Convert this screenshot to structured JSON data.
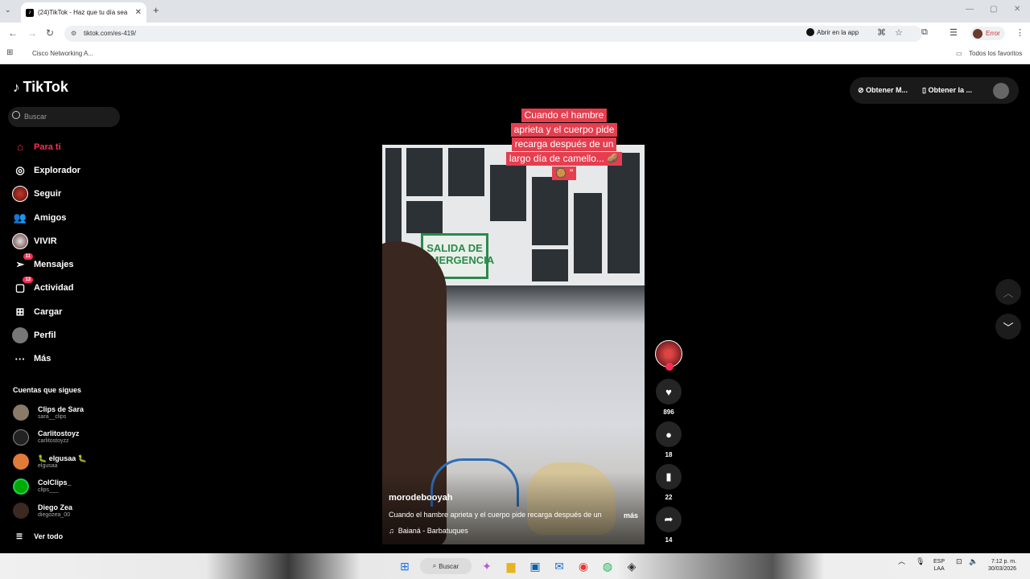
{
  "browser": {
    "tab_title": "(24)TikTok - Haz que tu día sea",
    "tab_close": "✕",
    "new_tab": "+",
    "url": "tiktok.com/es-419/",
    "open_in_app": "Abrir en la app",
    "error_label": "Error",
    "bookmark_1": "Cisco Networking A...",
    "bookmark_all": "Todos los favoritos"
  },
  "tiktok": {
    "logo": "TikTok",
    "search_placeholder": "Buscar",
    "nav": [
      {
        "label": "Para ti",
        "icon": "home-icon"
      },
      {
        "label": "Explorador",
        "icon": "compass-icon"
      },
      {
        "label": "Seguir",
        "icon": "following-avatar-icon"
      },
      {
        "label": "Amigos",
        "icon": "friends-icon"
      },
      {
        "label": "VIVIR",
        "icon": "live-icon"
      },
      {
        "label": "Mensajes",
        "icon": "messages-icon",
        "badge": "11"
      },
      {
        "label": "Actividad",
        "icon": "activity-icon",
        "badge": "13"
      },
      {
        "label": "Cargar",
        "icon": "upload-icon"
      },
      {
        "label": "Perfil",
        "icon": "profile-icon"
      },
      {
        "label": "Más",
        "icon": "more-icon"
      }
    ],
    "following_title": "Cuentas que sigues",
    "following": [
      {
        "name": "Clips de Sara",
        "handle": "sara__clips"
      },
      {
        "name": "Carlitostoyz",
        "handle": "carlitostoyzz"
      },
      {
        "name": "🐛 elgusaa 🐛",
        "handle": "elgusaa"
      },
      {
        "name": "ColClips_",
        "handle": "clips___"
      },
      {
        "name": "Diego Zea",
        "handle": "diegozea_00"
      }
    ],
    "see_all": "Ver todo",
    "get_coins": "Obtener M...",
    "get_app": "Obtener la ...",
    "video": {
      "caption_lines": [
        "Cuando el hambre",
        "aprieta y el cuerpo pide",
        "recarga después de un",
        "largo día de camello... 🥔",
        "🥘 \""
      ],
      "sign": "SALIDA DE EMERGENCIA",
      "username": "morodebooyah",
      "description": "Cuando el hambre aprieta y el cuerpo pide recarga después de un",
      "more": "más",
      "music": "Baianá - Barbatuques",
      "likes": "896",
      "comments": "18",
      "saves": "22",
      "shares": "14"
    }
  },
  "taskbar": {
    "search": "Buscar",
    "lang_1": "ESP",
    "lang_2": "LAA",
    "time": "7:12 p. m.",
    "date": "30/03/2026"
  }
}
